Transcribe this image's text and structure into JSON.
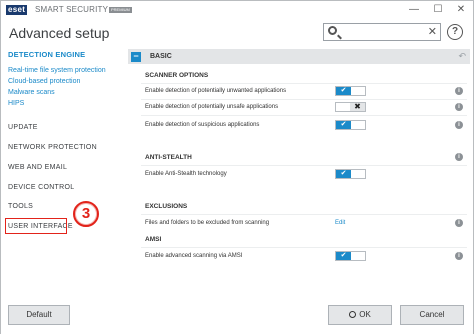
{
  "app": {
    "logo": "eset",
    "brand": "SMART SECURITY",
    "brand_tag": "PREMIUM",
    "title": "Advanced setup"
  },
  "window_controls": {
    "minimize": "—",
    "maximize": "☐",
    "close": "✕"
  },
  "search": {
    "placeholder": "",
    "clear": "✕"
  },
  "help": "?",
  "sidebar": {
    "heading": "DETECTION ENGINE",
    "subitems": [
      "Real-time file system protection",
      "Cloud-based protection",
      "Malware scans",
      "HIPS"
    ],
    "items": [
      "UPDATE",
      "NETWORK PROTECTION",
      "WEB AND EMAIL",
      "DEVICE CONTROL",
      "TOOLS",
      "USER INTERFACE"
    ],
    "highlighted_item": "USER INTERFACE"
  },
  "callout_step": "3",
  "section": {
    "title": "BASIC",
    "collapse": "−",
    "reset": "↶"
  },
  "groups": {
    "scanner_options": {
      "title": "SCANNER OPTIONS",
      "rows": [
        {
          "label": "Enable detection of potentially unwanted applications",
          "state": "on"
        },
        {
          "label": "Enable detection of potentially unsafe applications",
          "state": "off"
        },
        {
          "label": "Enable detection of suspicious applications",
          "state": "on"
        }
      ]
    },
    "anti_stealth": {
      "title": "ANTI-STEALTH",
      "rows": [
        {
          "label": "Enable Anti-Stealth technology",
          "state": "on"
        }
      ]
    },
    "exclusions": {
      "title": "EXCLUSIONS",
      "rows": [
        {
          "label": "Files and folders to be excluded from scanning",
          "action": "Edit"
        }
      ]
    },
    "amsi": {
      "title": "AMSI",
      "rows": [
        {
          "label": "Enable advanced scanning via AMSI",
          "state": "on"
        }
      ]
    }
  },
  "toggle_glyphs": {
    "on": "✔",
    "off": "✖"
  },
  "info_glyph": "i",
  "footer": {
    "default": "Default",
    "ok": "OK",
    "cancel": "Cancel"
  },
  "colors": {
    "accent": "#1b8ac9",
    "highlight": "#e2231a",
    "section_bg": "#e3e5e7"
  }
}
